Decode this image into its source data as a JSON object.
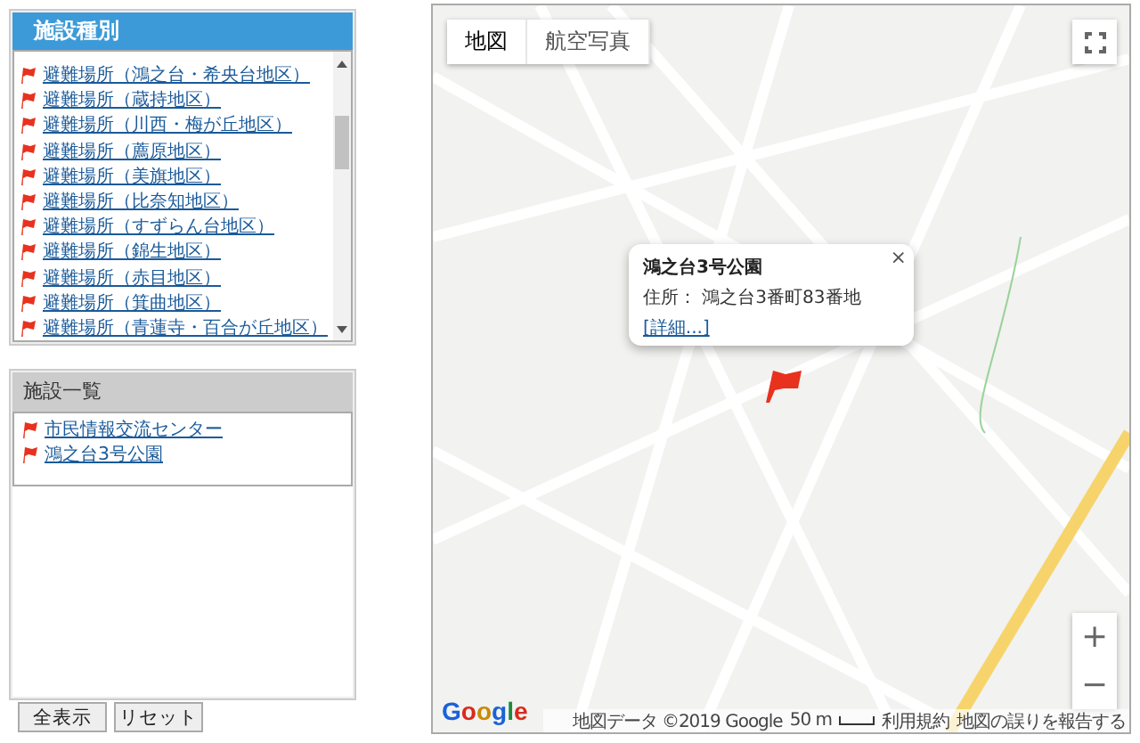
{
  "facility_types": {
    "title": "施設種別",
    "items": [
      {
        "label": "避難場所（鴻之台・希央台地区）"
      },
      {
        "label": "避難場所（蔵持地区）"
      },
      {
        "label": "避難場所（川西・梅が丘地区）"
      },
      {
        "label": "避難場所（薦原地区）"
      },
      {
        "label": "避難場所（美旗地区）"
      },
      {
        "label": "避難場所（比奈知地区）"
      },
      {
        "label": "避難場所（すずらん台地区）"
      },
      {
        "label": "避難場所（錦生地区）"
      },
      {
        "label": "避難場所（赤目地区）"
      },
      {
        "label": "避難場所（箕曲地区）"
      },
      {
        "label": "避難場所（青蓮寺・百合が丘地区）"
      }
    ]
  },
  "facility_list": {
    "title": "施設一覧",
    "items": [
      {
        "label": "市民情報交流センター"
      },
      {
        "label": "鴻之台3号公園"
      }
    ]
  },
  "buttons": [
    "全表示",
    "リセット"
  ],
  "map": {
    "type_buttons": [
      {
        "label": "地図",
        "selected": true
      },
      {
        "label": "航空写真",
        "selected": false
      }
    ],
    "info_window": {
      "title": "鴻之台3号公園",
      "address": "住所： 鴻之台3番町83番地",
      "link": "[詳細...]",
      "close": "×"
    },
    "zoom_in": "+",
    "zoom_out": "−",
    "logo": "Google",
    "attribution": "地図データ ©2019 Google",
    "scale": "50 m",
    "terms": "利用規約",
    "report": "地図の誤りを報告する"
  }
}
